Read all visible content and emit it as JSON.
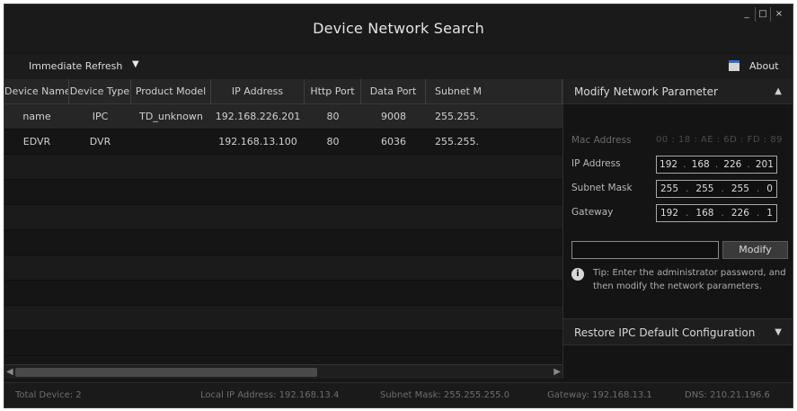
{
  "window": {
    "title": "Device Network Search",
    "controls": [
      "_",
      "□",
      "×"
    ]
  },
  "toolbar": {
    "refresh_label": "Immediate Refresh",
    "refresh_caret": "▼",
    "about_label": "About",
    "about_icon": "about-icon"
  },
  "table": {
    "columns": [
      "Device Name",
      "Device Type",
      "Product Model",
      "IP Address",
      "Http Port",
      "Data Port",
      "Subnet M"
    ],
    "rows": [
      [
        "name",
        "IPC",
        "TD_unknown",
        "192.168.226.201",
        "80",
        "9008",
        "255.255."
      ],
      [
        "EDVR",
        "DVR",
        "",
        "192.168.13.100",
        "80",
        "6036",
        "255.255."
      ]
    ]
  },
  "panel": {
    "title": "Modify Network Parameter",
    "caret": "▲",
    "mac_label": "Mac Address",
    "mac_value": "00 : 18 : AE : 6D : FD : 89",
    "ip_label": "IP Address",
    "ip": [
      "192",
      "168",
      "226",
      "201"
    ],
    "mask_label": "Subnet Mask",
    "mask": [
      "255",
      "255",
      "255",
      "0"
    ],
    "gateway_label": "Gateway",
    "gateway": [
      "192",
      "168",
      "226",
      "1"
    ],
    "password_value": "",
    "modify_label": "Modify",
    "info_icon": "i",
    "tip": "Tip: Enter the administrator password, and then modify the network parameters.",
    "restore_label": "Restore IPC Default Configuration",
    "restore_caret": "▼"
  },
  "status": {
    "total": "Total Device: 2",
    "local_ip": "Local IP Address: 192.168.13.4",
    "subnet": "Subnet Mask: 255.255.255.0",
    "gateway": "Gateway: 192.168.13.1",
    "dns": "DNS: 210.21.196.6"
  },
  "colors": {
    "background": "#161616",
    "header": "#262626",
    "accent": "#2f6bd6"
  }
}
